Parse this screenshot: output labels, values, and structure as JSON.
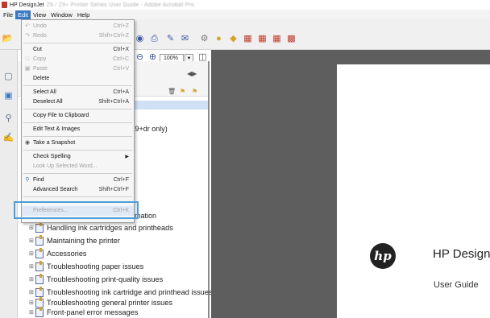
{
  "window": {
    "title": "HP DesignJet",
    "title_blurred": "Z6 / Z9+ Printer Series User Guide - Adobe Acrobat Pro"
  },
  "menubar": {
    "items": [
      "File",
      "Edit",
      "View",
      "Window",
      "Help"
    ],
    "active": "Edit"
  },
  "toolbar": {
    "zoom_value": "100%"
  },
  "edit_menu": {
    "items": [
      {
        "label": "Undo",
        "shortcut": "Ctrl+Z",
        "enabled": false,
        "icon": "undo-icon"
      },
      {
        "label": "Redo",
        "shortcut": "Shift+Ctrl+Z",
        "enabled": false,
        "icon": "redo-icon"
      },
      {
        "label": "Cut",
        "shortcut": "Ctrl+X",
        "enabled": true
      },
      {
        "label": "Copy",
        "shortcut": "Ctrl+C",
        "enabled": false,
        "icon": "copy-icon"
      },
      {
        "label": "Paste",
        "shortcut": "Ctrl+V",
        "enabled": false,
        "icon": "paste-icon"
      },
      {
        "label": "Delete",
        "shortcut": "",
        "enabled": true
      },
      {
        "label": "Select All",
        "shortcut": "Ctrl+A",
        "enabled": true
      },
      {
        "label": "Deselect All",
        "shortcut": "Shift+Ctrl+A",
        "enabled": true
      },
      {
        "label": "Copy File to Clipboard",
        "shortcut": "",
        "enabled": true
      },
      {
        "label": "Edit Text & Images",
        "shortcut": "",
        "enabled": true
      },
      {
        "label": "Take a Snapshot",
        "shortcut": "",
        "enabled": true,
        "icon": "camera-icon"
      },
      {
        "label": "Check Spelling",
        "shortcut": "",
        "enabled": true,
        "submenu": true
      },
      {
        "label": "Look Up Selected Word...",
        "shortcut": "",
        "enabled": false
      },
      {
        "label": "Find",
        "shortcut": "Ctrl+F",
        "enabled": true,
        "icon": "search-icon"
      },
      {
        "label": "Advanced Search",
        "shortcut": "Shift+Ctrl+F",
        "enabled": true
      },
      {
        "label": "Preferences...",
        "shortcut": "Ctrl+K",
        "enabled": true,
        "highlighted": true
      }
    ]
  },
  "bookmarks": {
    "partial_texts": [
      "Z9+dr only)",
      "rmation"
    ],
    "items": [
      "Handling ink cartridges and printheads",
      "Maintaining the printer",
      "Accessories",
      "Troubleshooting paper issues",
      "Troubleshooting print-quality issues",
      "Troubleshooting ink cartridge and printhead issues",
      "Troubleshooting general printer issues",
      "Front-panel error messages"
    ]
  },
  "document_page": {
    "logo_text": "hp",
    "title": "HP Design",
    "subtitle": "User Guide"
  },
  "colors": {
    "menu_active": "#3a78c2",
    "callout_border": "#4a9fd8",
    "document_background": "#5e5e5e"
  }
}
